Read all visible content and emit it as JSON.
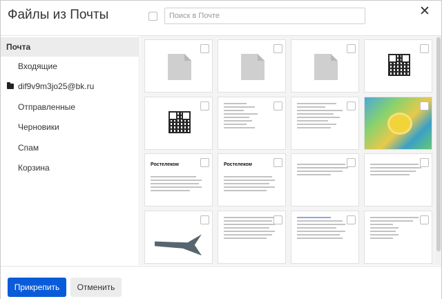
{
  "dialog": {
    "title": "Файлы из Почты",
    "search_placeholder": "Поиск в Почте",
    "close_glyph": "✕"
  },
  "sidebar": {
    "items": [
      {
        "label": "Почта",
        "active": true
      },
      {
        "label": "Входящие"
      },
      {
        "label": "dif9v9m3jo25@bk.ru",
        "icon": "folder-icon"
      },
      {
        "label": "Отправленные"
      },
      {
        "label": "Черновики"
      },
      {
        "label": "Спам"
      },
      {
        "label": "Корзина"
      }
    ]
  },
  "files": [
    {
      "thumb": "file-icon"
    },
    {
      "thumb": "file-icon"
    },
    {
      "thumb": "file-icon"
    },
    {
      "thumb": "qr-code"
    },
    {
      "thumb": "qr-code"
    },
    {
      "thumb": "document"
    },
    {
      "thumb": "document"
    },
    {
      "thumb": "photo-collage"
    },
    {
      "thumb": "document-logo",
      "logo_text": "Ростелеком"
    },
    {
      "thumb": "document-logo",
      "logo_text": "Ростелеком"
    },
    {
      "thumb": "document"
    },
    {
      "thumb": "document"
    },
    {
      "thumb": "poster-plane"
    },
    {
      "thumb": "document"
    },
    {
      "thumb": "document"
    },
    {
      "thumb": "document"
    }
  ],
  "footer": {
    "attach_label": "Прикрепить",
    "cancel_label": "Отменить"
  },
  "colors": {
    "primary_button": "#0a5bd9",
    "active_sidebar": "#ececec"
  }
}
